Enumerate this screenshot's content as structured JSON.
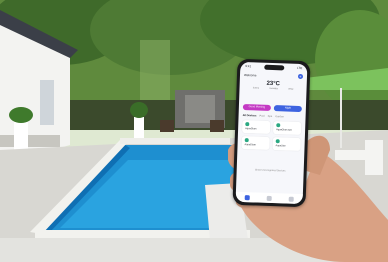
{
  "scene": {
    "colors": {
      "sky": "#dfe9d2",
      "trees": "#4e7a34",
      "house": "#f3f3f1",
      "deck": "#d8d7d2",
      "pool_water": "#1e8fd0",
      "pool_deep": "#0f6fb3",
      "umbrella": "#7cc25d",
      "hand": "#d9a184"
    }
  },
  "phone": {
    "status_time": "9:41",
    "status_signal": "LTE",
    "app_header": "Welcome",
    "weather": {
      "temperature": "23°C",
      "details": [
        "Sunny",
        "Humidity",
        "Wind"
      ]
    },
    "scene_buttons": [
      {
        "label": "Good Morning",
        "color": "#c43ac4"
      },
      {
        "label": "Night",
        "color": "#3d63e0"
      }
    ],
    "tabs": [
      "All Devices",
      "Pool",
      "Spa",
      "Garden"
    ],
    "devices": [
      {
        "name": "AquaGlam"
      },
      {
        "name": "AquaGlam Set"
      },
      {
        "name": "AquaGlam"
      },
      {
        "name": "AquaStar"
      }
    ],
    "footer_link": "Show Unrecognized Devices"
  }
}
